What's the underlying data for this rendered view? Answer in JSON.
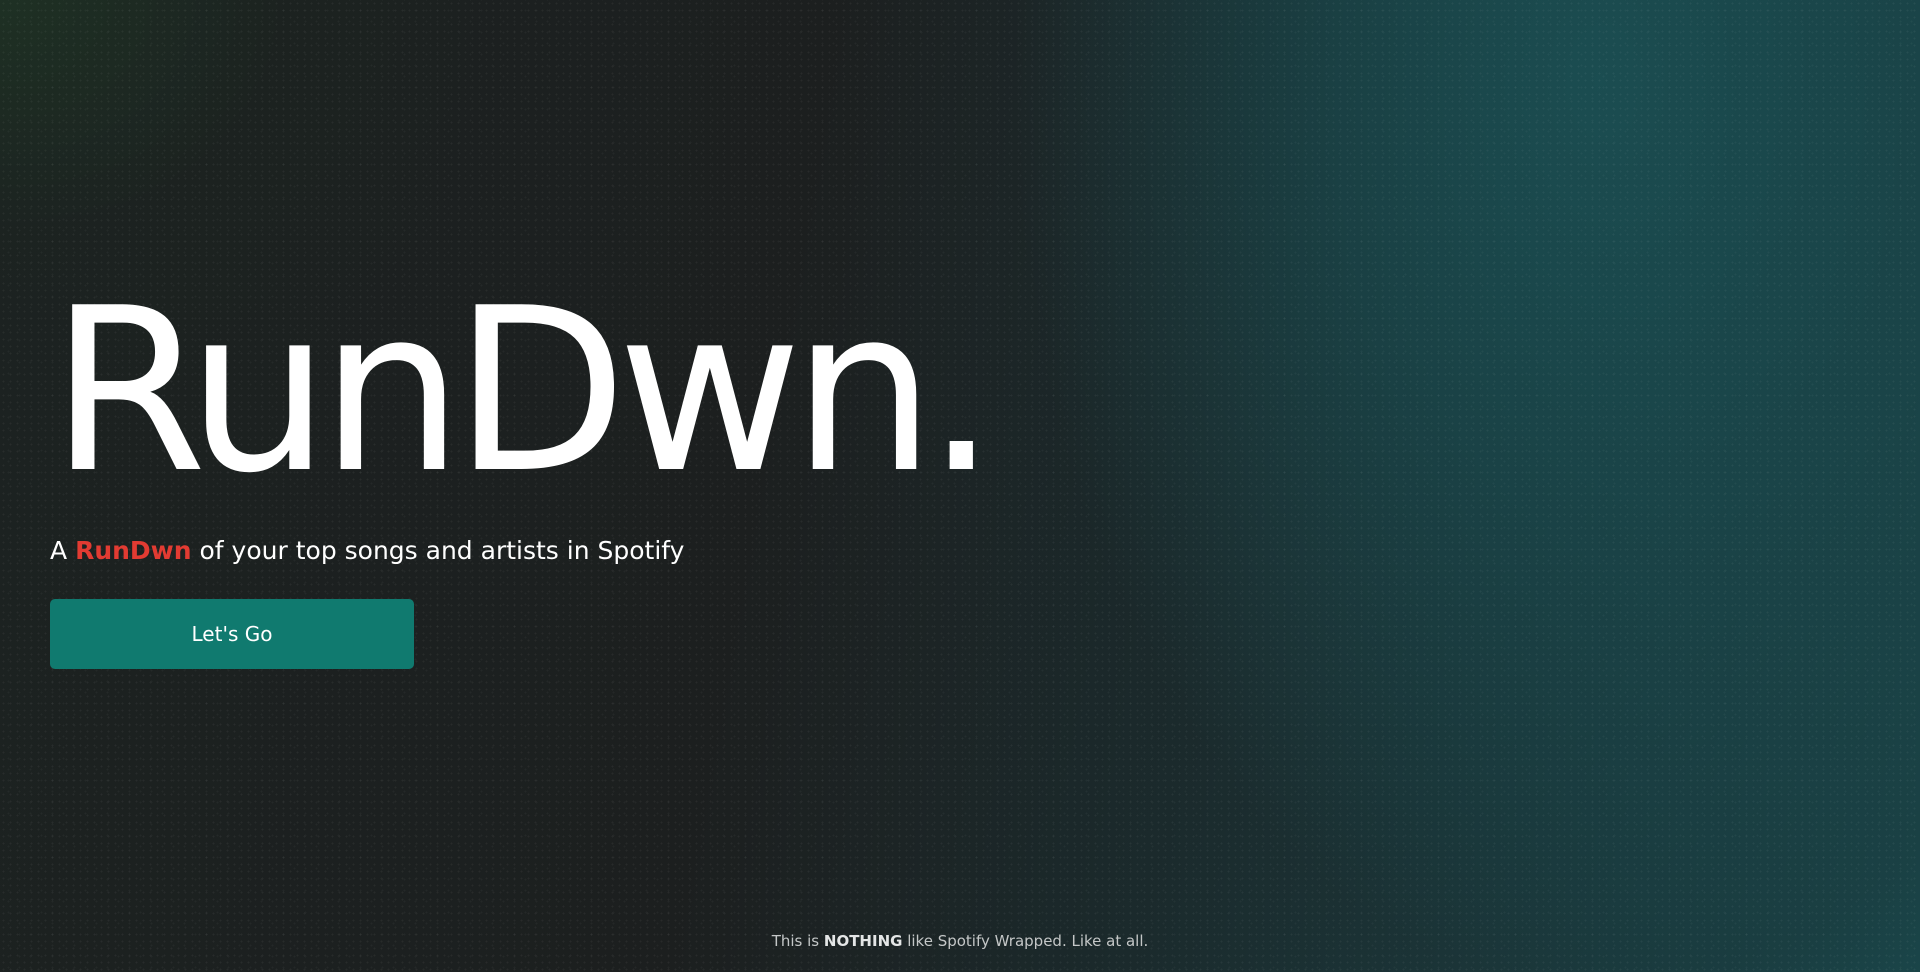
{
  "hero": {
    "logo_text": "RunDwn."
  },
  "tagline": {
    "prefix": "A",
    "brand": "RunDwn",
    "suffix": "of your top songs and artists in Spotify"
  },
  "cta": {
    "label": "Let's Go"
  },
  "footer": {
    "prefix": "This is",
    "emphasis": "NOTHING",
    "suffix": "like Spotify Wrapped. Like at all."
  },
  "colors": {
    "accent_button": "#107a6f",
    "brand_red": "#e23b32",
    "background_dark": "#1c1f1f",
    "background_teal": "#1a4a4e"
  }
}
